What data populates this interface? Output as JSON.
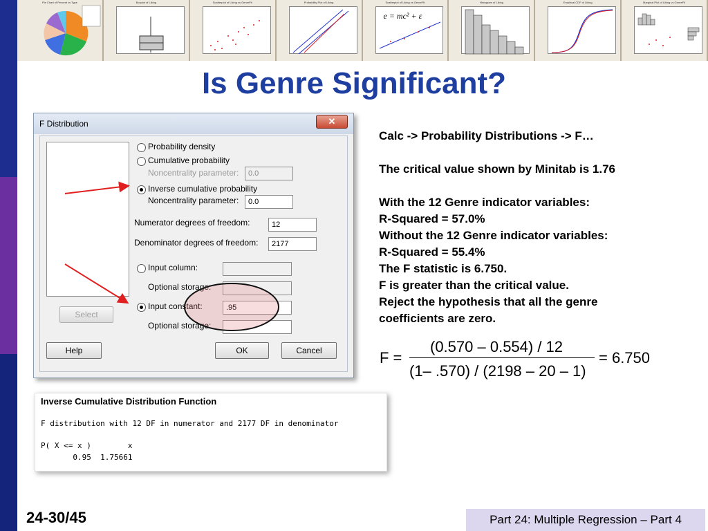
{
  "title": "Is Genre Significant?",
  "thumbnails": [
    {
      "title": "Pie Chart of Percent vs Type"
    },
    {
      "title": "Boxplot of Liking"
    },
    {
      "title": "Scatterplot of Liking vs GenreFit"
    },
    {
      "title": "Probability Plot of Liking"
    },
    {
      "title": "Scatterplot of Liking vs GenreFit"
    },
    {
      "title": "Histogram of Liking"
    },
    {
      "title": "Empirical CDF of Liking"
    },
    {
      "title": "Marginal Plot of Liking vs GenreFit"
    }
  ],
  "thumb_equation": "e = mc² + ε",
  "dialog": {
    "title": "F Distribution",
    "close_label": "✕",
    "prob_density": "Probability density",
    "cum_prob": "Cumulative probability",
    "noncentrality_label": "Noncentrality parameter:",
    "noncentrality_value_dis": "0.0",
    "inverse_cum": "Inverse cumulative probability",
    "noncentrality_value": "0.0",
    "num_df_label": "Numerator degrees of freedom:",
    "num_df_value": "12",
    "den_df_label": "Denominator degrees of freedom:",
    "den_df_value": "2177",
    "input_column": "Input column:",
    "optional_storage_1": "Optional storage:",
    "input_constant": "Input constant:",
    "input_constant_value": ".95",
    "optional_storage_2": "Optional storage:",
    "select_label": "Select",
    "help_label": "Help",
    "ok_label": "OK",
    "cancel_label": "Cancel"
  },
  "session": {
    "header": "Inverse Cumulative Distribution Function",
    "line1": "F distribution with 12 DF in numerator and 2177 DF in denominator",
    "line2": "P( X <= x )        x",
    "line3": "       0.95  1.75661"
  },
  "right_text": {
    "menu_path": "Calc -> Probability Distributions -> F…",
    "critical": "The critical value  shown by Minitab is 1.76",
    "with_line": "With the 12 Genre indicator variables:",
    "r2_with": "R-Squared = 57.0%",
    "without_line": "Without the 12 Genre indicator variables:",
    "r2_without": "R-Squared = 55.4%",
    "fstat": "The F statistic is 6.750.",
    "greater": "F is greater than the critical value.",
    "reject1": "Reject the hypothesis that all the genre",
    "reject2": "coefficients are zero."
  },
  "formula": {
    "lhs": "F =",
    "numerator": "(0.570 – 0.554) / 12",
    "denominator": "(1– .570) / (2198 – 20 – 1)",
    "result": "= 6.750"
  },
  "footer": {
    "slide_number": "24-30/45",
    "part": "Part 24: Multiple Regression – Part 4"
  },
  "colors": {
    "title": "#1f3fa0",
    "left_bar_top": "#1c2d8f",
    "left_bar_mid": "#6b2fa0",
    "footer_bg": "#dcd7ef",
    "annotation": "#e02020"
  }
}
